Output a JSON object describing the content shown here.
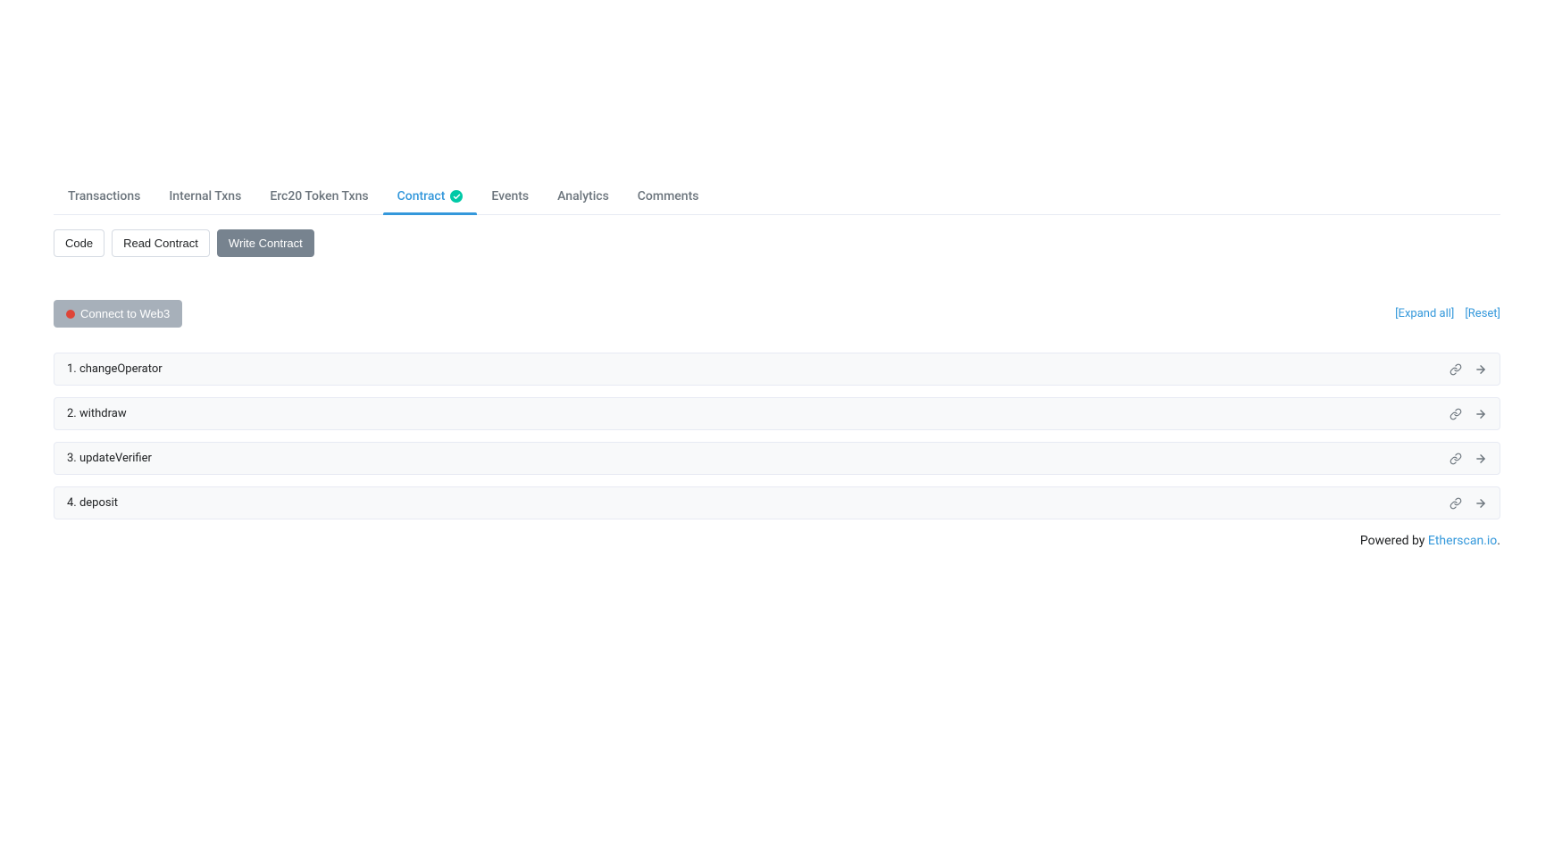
{
  "tabs": [
    {
      "label": "Transactions",
      "active": false
    },
    {
      "label": "Internal Txns",
      "active": false
    },
    {
      "label": "Erc20 Token Txns",
      "active": false
    },
    {
      "label": "Contract",
      "active": true,
      "verified": true
    },
    {
      "label": "Events",
      "active": false
    },
    {
      "label": "Analytics",
      "active": false
    },
    {
      "label": "Comments",
      "active": false
    }
  ],
  "sub_tabs": [
    {
      "label": "Code",
      "active": false
    },
    {
      "label": "Read Contract",
      "active": false
    },
    {
      "label": "Write Contract",
      "active": true
    }
  ],
  "toolbar": {
    "connect_label": "Connect to Web3",
    "expand_label": "[Expand all]",
    "reset_label": "[Reset]"
  },
  "functions": [
    {
      "label": "1. changeOperator"
    },
    {
      "label": "2. withdraw"
    },
    {
      "label": "3. updateVerifier"
    },
    {
      "label": "4. deposit"
    }
  ],
  "footer": {
    "prefix": "Powered by ",
    "link": "Etherscan.io",
    "suffix": "."
  }
}
